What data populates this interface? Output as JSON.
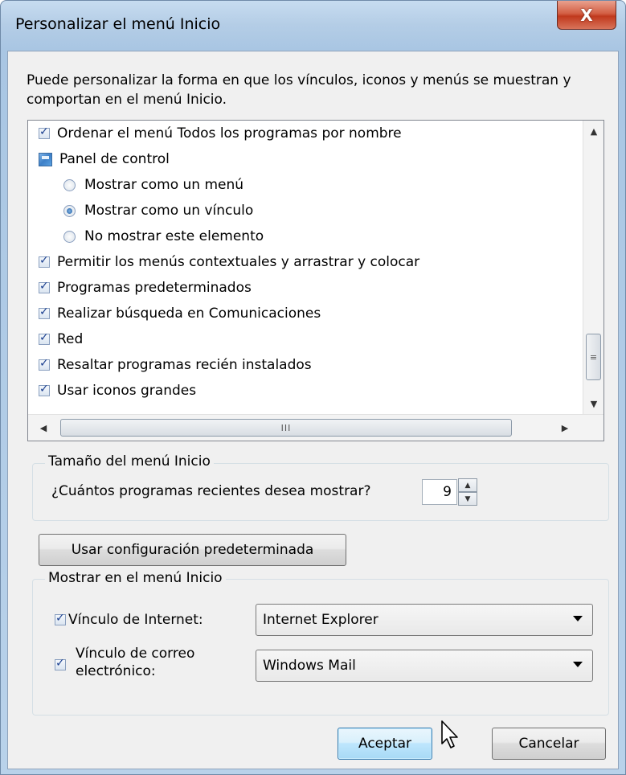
{
  "window": {
    "title": "Personalizar el menú Inicio",
    "close_label": "X"
  },
  "description": "Puede personalizar la forma en que los vínculos, iconos y menús se muestran y comportan en el menú Inicio.",
  "options": [
    {
      "type": "checkbox",
      "label": "Ordenar el menú Todos los programas por nombre",
      "checked": true
    },
    {
      "type": "header",
      "label": "Panel de control",
      "icon": "control-panel-icon"
    },
    {
      "type": "radio",
      "label": "Mostrar como un menú",
      "checked": false
    },
    {
      "type": "radio",
      "label": "Mostrar como un vínculo",
      "checked": true
    },
    {
      "type": "radio",
      "label": "No mostrar este elemento",
      "checked": false
    },
    {
      "type": "checkbox",
      "label": "Permitir los menús contextuales y arrastrar y colocar",
      "checked": true
    },
    {
      "type": "checkbox",
      "label": "Programas predeterminados",
      "checked": true
    },
    {
      "type": "checkbox",
      "label": "Realizar búsqueda en Comunicaciones",
      "checked": true
    },
    {
      "type": "checkbox",
      "label": "Red",
      "checked": true
    },
    {
      "type": "checkbox",
      "label": "Resaltar programas recién instalados",
      "checked": true
    },
    {
      "type": "checkbox",
      "label": "Usar iconos grandes",
      "checked": true
    }
  ],
  "scrollbars": {
    "vertical_grip": "≡",
    "horizontal_grip": "III"
  },
  "size_group": {
    "label": "Tamaño del menú Inicio",
    "recent_label": "¿Cuántos programas recientes desea mostrar?",
    "recent_value": "9"
  },
  "default_settings_button": "Usar configuración predeterminada",
  "show_group": {
    "label": "Mostrar en el menú Inicio",
    "internet_label": "Vínculo de Internet:",
    "internet_checked": true,
    "internet_value": "Internet Explorer",
    "email_label_line1": "Vínculo de correo",
    "email_label_line2": "electrónico:",
    "email_checked": true,
    "email_value": "Windows Mail"
  },
  "buttons": {
    "ok": "Aceptar",
    "cancel": "Cancelar"
  }
}
